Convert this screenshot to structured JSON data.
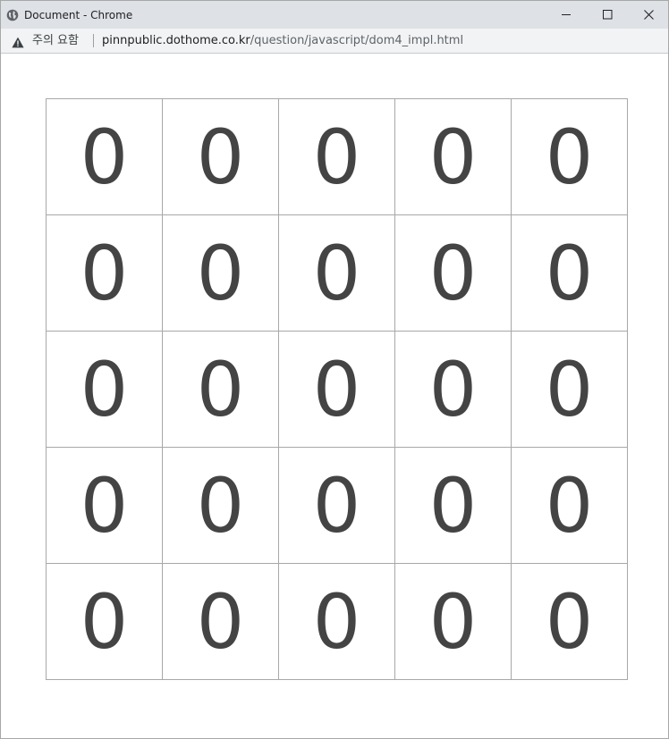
{
  "window": {
    "title": "Document - Chrome"
  },
  "address_bar": {
    "security_label": "주의 요함",
    "url_host": "pinnpublic.dothome.co.kr",
    "url_path": "/question/javascript/dom4_impl.html"
  },
  "grid": {
    "rows": [
      [
        "0",
        "0",
        "0",
        "0",
        "0"
      ],
      [
        "0",
        "0",
        "0",
        "0",
        "0"
      ],
      [
        "0",
        "0",
        "0",
        "0",
        "0"
      ],
      [
        "0",
        "0",
        "0",
        "0",
        "0"
      ],
      [
        "0",
        "0",
        "0",
        "0",
        "0"
      ]
    ]
  },
  "icons": {
    "app": "globe-icon",
    "minimize": "minimize-icon",
    "maximize": "maximize-icon",
    "close": "close-icon",
    "warning": "warning-icon"
  },
  "colors": {
    "titlebar": "#dee1e6",
    "addressbar": "#f1f3f4",
    "cell_border": "#a8a8a8",
    "cell_text": "#444444"
  }
}
